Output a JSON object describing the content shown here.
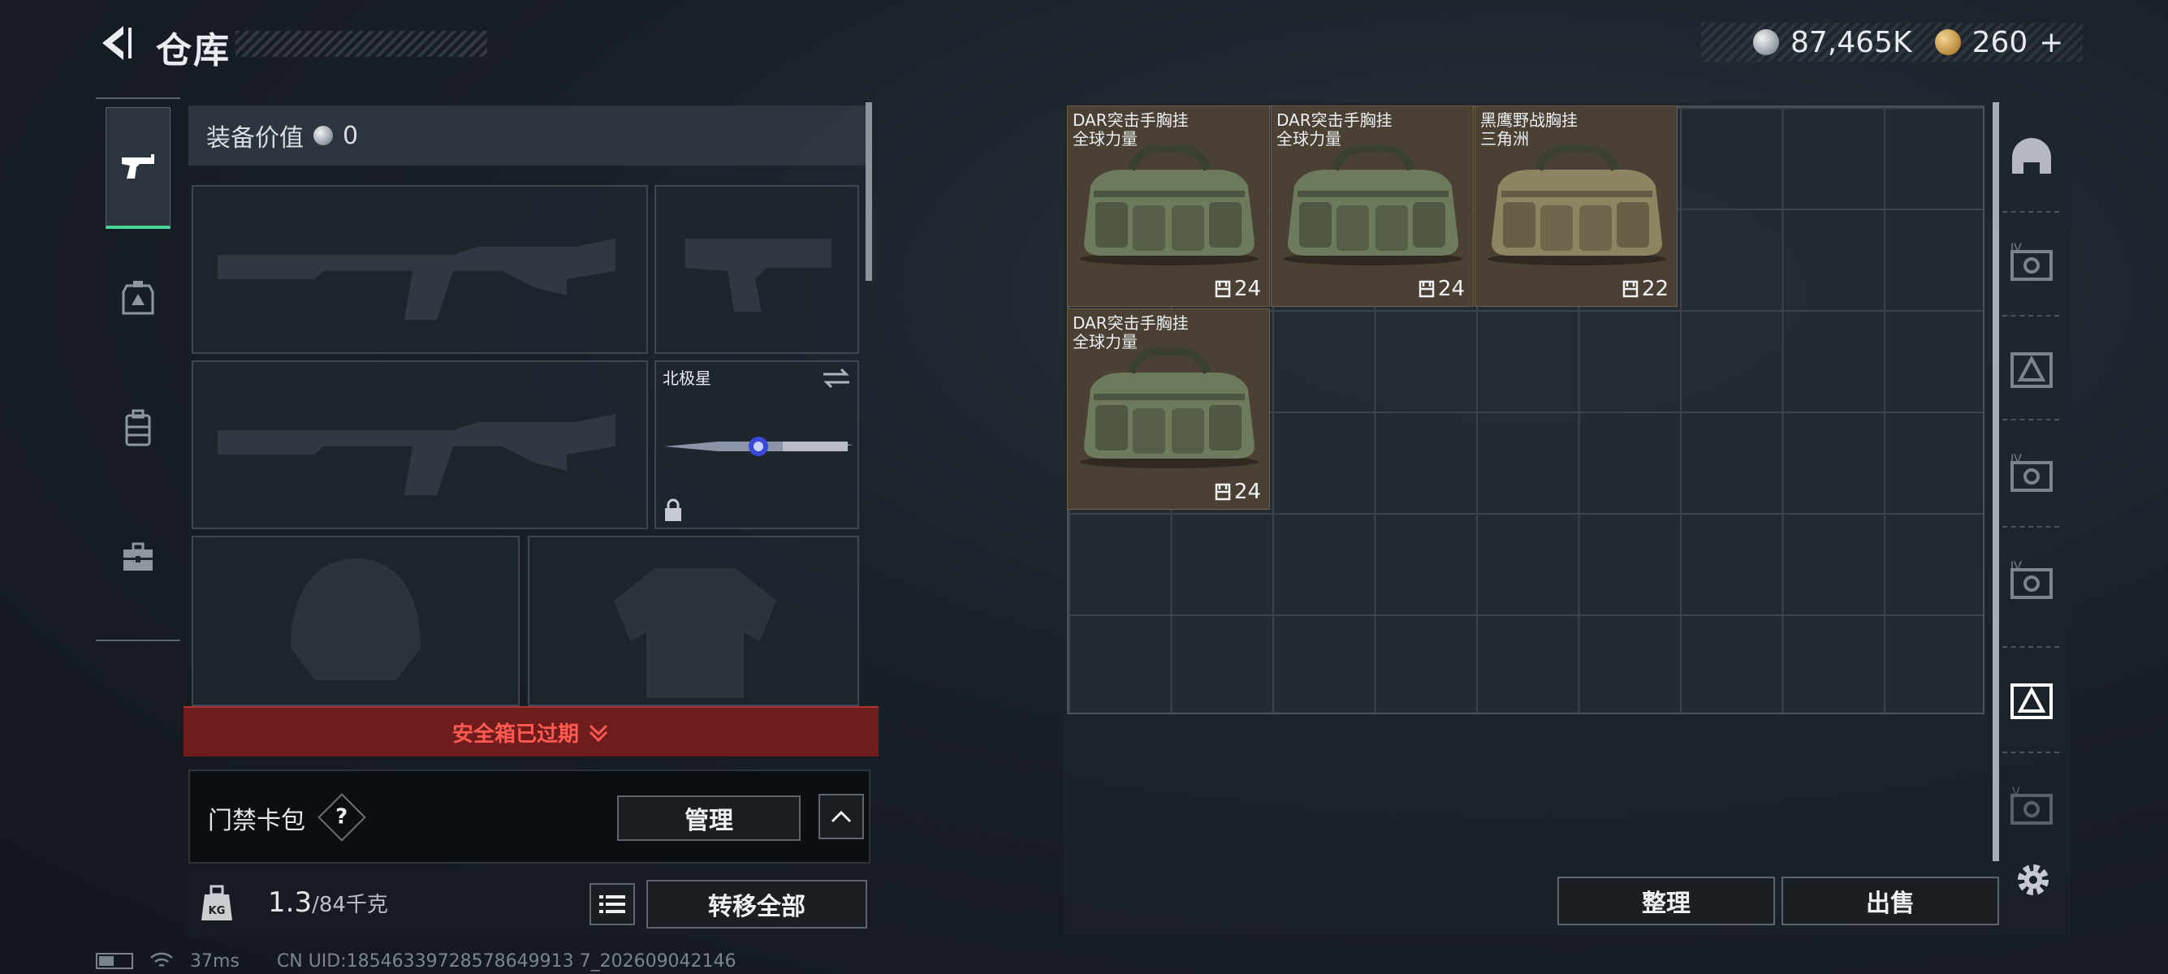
{
  "header": {
    "title": "仓库",
    "currency": [
      {
        "icon": "silver-coin-icon",
        "value": "87,465K"
      },
      {
        "icon": "gold-coin-icon",
        "value": "260"
      }
    ],
    "add_symbol": "+"
  },
  "tabs": [
    {
      "icon": "pistol-icon",
      "active": true
    },
    {
      "icon": "armor-tag-icon",
      "active": false
    },
    {
      "icon": "backpack-icon",
      "active": false
    },
    {
      "icon": "toolbox-icon",
      "active": false
    }
  ],
  "equipment": {
    "value_label": "装备价值",
    "value": "0",
    "melee_name": "北极星",
    "slots": [
      "primary-weapon-1",
      "pistol",
      "primary-weapon-2",
      "melee",
      "helmet",
      "body-armor"
    ]
  },
  "safe_box": {
    "label": "安全箱已过期"
  },
  "card_pack": {
    "label": "门禁卡包",
    "help": "?",
    "manage_label": "管理"
  },
  "weight": {
    "current": "1.3",
    "max": "/84千克",
    "kg_icon_text": "KG"
  },
  "transfer_label": "转移全部",
  "storage": {
    "items": [
      {
        "name_line1": "DAR突击手胸挂",
        "name_line2": "全球力量",
        "count": "24"
      },
      {
        "name_line1": "DAR突击手胸挂",
        "name_line2": "全球力量",
        "count": "24"
      },
      {
        "name_line1": "黑鹰野战胸挂",
        "name_line2": "三角洲",
        "count": "22"
      },
      {
        "name_line1": "DAR突击手胸挂",
        "name_line2": "全球力量",
        "count": "24"
      }
    ]
  },
  "side_icons": [
    "helmet-icon",
    "rack-iv-icon",
    "rack-triangle-icon",
    "rack-iv-icon",
    "rack-iv-icon",
    "rack-triangle-icon",
    "rack-v-icon"
  ],
  "tidy_label": "整理",
  "sell_label": "出售",
  "status": {
    "ping": "37ms",
    "uid": "CN UID:18546339728578649913 7_202609042146"
  }
}
